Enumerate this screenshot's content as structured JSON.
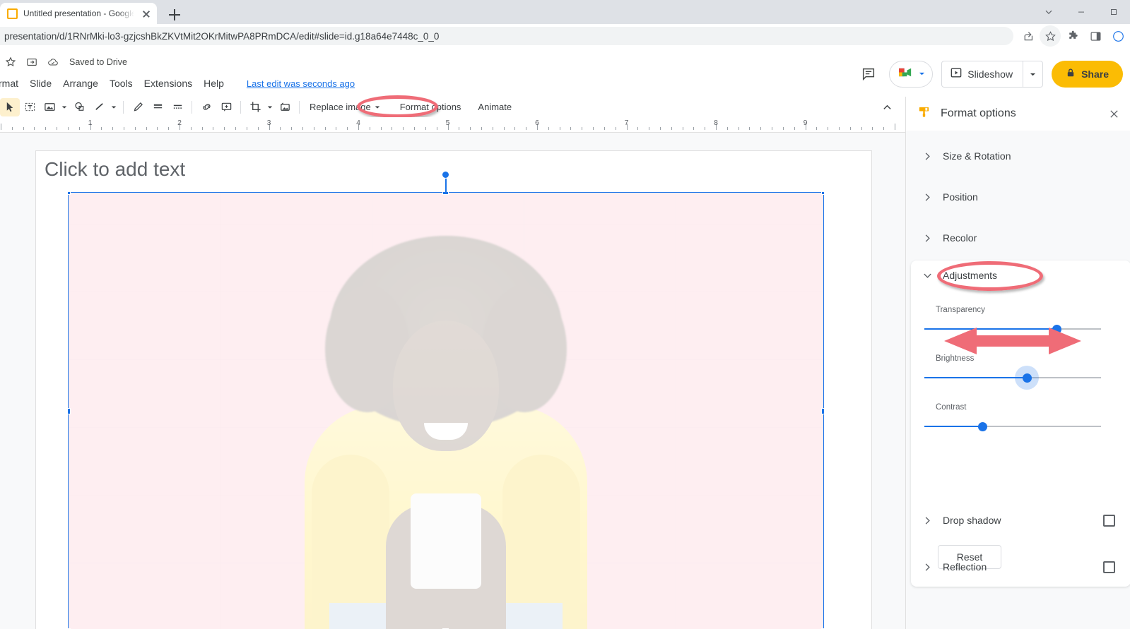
{
  "browser": {
    "tab": {
      "title": "Untitled presentation - Google S",
      "favicon": "slides-favicon",
      "close": "close-icon"
    },
    "new_tab": "new-tab-icon",
    "url": "presentation/d/1RNrMki-lo3-gzjcshBkZKVtMit2OKrMitwPA8PRmDCA/edit#slide=id.g18a64e7448c_0_0",
    "toolbar_icons": [
      "share-icon",
      "bookmark-star-icon",
      "extensions-puzzle-icon",
      "side-panel-icon"
    ],
    "window_controls": [
      "chevron-down-icon",
      "minimize-icon",
      "maximize-icon"
    ]
  },
  "app": {
    "saved_status": "Saved to Drive",
    "star_icon": "star-icon",
    "move_folder_icon": "move-to-folder-icon",
    "cloud_icon": "cloud-saved-icon",
    "menus": [
      "rmat",
      "Slide",
      "Arrange",
      "Tools",
      "Extensions",
      "Help"
    ],
    "last_edit": "Last edit was seconds ago",
    "comment_icon": "comment-history-icon",
    "meet_icon": "google-meet-icon",
    "slideshow_label": "Slideshow",
    "slideshow_icon": "present-play-icon",
    "slideshow_caret": "chevron-down-icon",
    "share_label": "Share",
    "share_icon": "lock-icon"
  },
  "toolbar": {
    "items": [
      {
        "name": "select-tool",
        "icon": "cursor-arrow-icon",
        "selected": true
      },
      {
        "name": "textbox-tool",
        "icon": "text-box-icon",
        "selected": false
      },
      {
        "name": "image-tool",
        "icon": "insert-image-icon",
        "selected": false,
        "caret": true
      },
      {
        "name": "shape-tool",
        "icon": "shapes-icon",
        "selected": false
      },
      {
        "name": "line-tool",
        "icon": "line-icon",
        "selected": false,
        "caret": true
      },
      {
        "name": "line-color-tool",
        "icon": "pen-color-icon",
        "selected": false
      },
      {
        "name": "line-weight-tool",
        "icon": "line-weight-icon",
        "selected": false
      },
      {
        "name": "line-dash-tool",
        "icon": "line-dash-icon",
        "selected": false
      },
      {
        "name": "insert-link",
        "icon": "link-icon",
        "selected": false
      },
      {
        "name": "add-comment",
        "icon": "add-comment-icon",
        "selected": false
      },
      {
        "name": "crop-tool",
        "icon": "crop-icon",
        "selected": false,
        "caret": true
      },
      {
        "name": "mask-image-tool",
        "icon": "image-mask-icon",
        "selected": false
      }
    ],
    "replace_image": "Replace image",
    "format_options": "Format options",
    "animate": "Animate",
    "collapse_icon": "chevron-up-icon"
  },
  "ruler": {
    "numbers": [
      "1",
      "2",
      "3",
      "4",
      "5",
      "6",
      "7",
      "8",
      "9"
    ]
  },
  "slide": {
    "placeholder": "Click to add text",
    "image_alt": "woman-with-curly-hair-using-phone-pink-wall"
  },
  "panel": {
    "title": "Format options",
    "icon": "format-paint-icon",
    "close_icon": "close-icon",
    "sections": [
      {
        "label": "Size & Rotation",
        "expanded": false,
        "checkbox": false
      },
      {
        "label": "Position",
        "expanded": false,
        "checkbox": false
      },
      {
        "label": "Recolor",
        "expanded": false,
        "checkbox": false
      },
      {
        "label": "Adjustments",
        "expanded": true,
        "checkbox": false
      },
      {
        "label": "Drop shadow",
        "expanded": false,
        "checkbox": true
      },
      {
        "label": "Reflection",
        "expanded": false,
        "checkbox": true
      }
    ],
    "adjustments": {
      "title": "Adjustments",
      "sliders": [
        {
          "label": "Transparency",
          "value_pct": 75,
          "focused": false
        },
        {
          "label": "Brightness",
          "value_pct": 58,
          "focused": true
        },
        {
          "label": "Contrast",
          "value_pct": 33,
          "focused": false
        }
      ],
      "reset_label": "Reset"
    }
  },
  "annotations": {
    "ellipse_format_options": "red-ellipse-highlight",
    "ellipse_adjustments": "red-ellipse-highlight",
    "double_arrow": "red-double-arrow-highlight"
  },
  "colors": {
    "accent_blue": "#1a73e8",
    "share_yellow": "#fbbc04",
    "annotation_red": "#ef6c77",
    "panel_bg": "#f8f9fa"
  }
}
